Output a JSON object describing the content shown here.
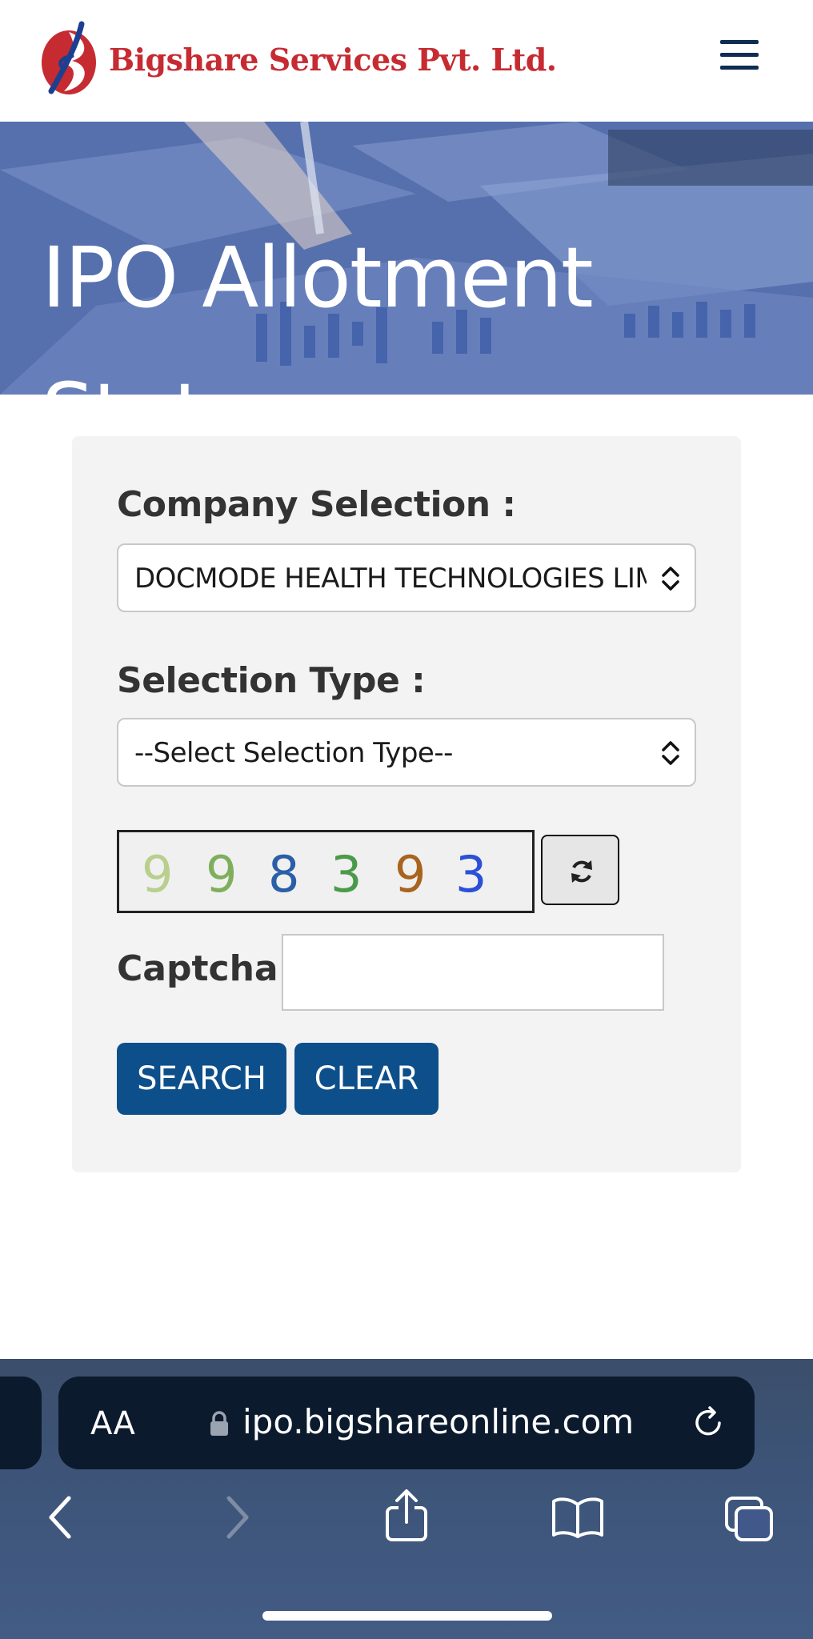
{
  "header": {
    "logo_text": "Bigshare Services Pvt. Ltd.",
    "logo_colors": {
      "red": "#c62b32",
      "blue": "#1d3f8f"
    },
    "menu_icon": "hamburger-menu-icon"
  },
  "hero": {
    "title": "IPO Allotment Status"
  },
  "form": {
    "company_label": "Company Selection :",
    "company_value": "DOCMODE HEALTH TECHNOLOGIES LIMITED",
    "selection_type_label": "Selection Type :",
    "selection_type_value": "--Select Selection Type--",
    "captcha_digits": [
      {
        "char": "9",
        "color": "#b9cf8d"
      },
      {
        "char": "9",
        "color": "#7fae5c"
      },
      {
        "char": "8",
        "color": "#2a5fa8"
      },
      {
        "char": "3",
        "color": "#4a9a4a"
      },
      {
        "char": "9",
        "color": "#a8641e"
      },
      {
        "char": "3",
        "color": "#2b4fd6"
      }
    ],
    "refresh_icon": "refresh-icon",
    "captcha_label": "Captcha :",
    "captcha_value": "",
    "search_label": "SEARCH",
    "clear_label": "CLEAR",
    "button_color": "#0d4f8b"
  },
  "browser": {
    "text_size_label": "AA",
    "url": "ipo.bigshareonline.com",
    "toolbar": [
      "back-icon",
      "forward-icon",
      "share-icon",
      "bookmarks-icon",
      "tabs-icon"
    ]
  }
}
